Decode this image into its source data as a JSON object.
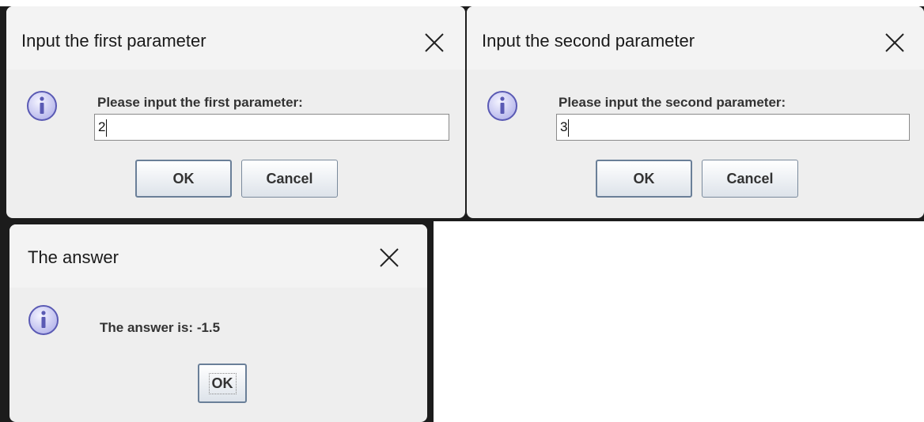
{
  "dialogs": {
    "first": {
      "title": "Input the first parameter",
      "message": "Please input the first parameter:",
      "input_value": "2",
      "ok_label": "OK",
      "cancel_label": "Cancel"
    },
    "second": {
      "title": "Input the second parameter",
      "message": "Please input the second parameter:",
      "input_value": "3",
      "ok_label": "OK",
      "cancel_label": "Cancel"
    },
    "answer": {
      "title": "The answer",
      "message": "The answer is: -1.5",
      "ok_label": "OK"
    }
  },
  "icons": {
    "close": "close-icon",
    "info": "info-icon"
  },
  "colors": {
    "dialog_bg": "#eeeeee",
    "titlebar_bg": "#f3f3f3",
    "info_icon_fill": "#c8c8f0",
    "info_icon_stroke": "#5a5ab4"
  }
}
